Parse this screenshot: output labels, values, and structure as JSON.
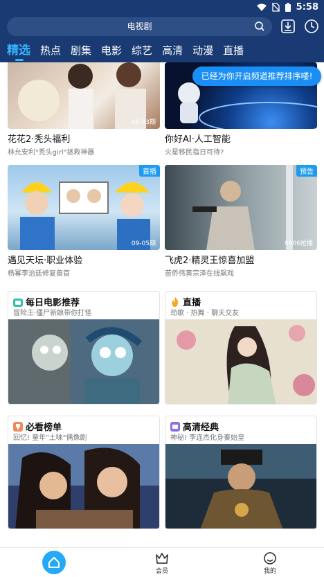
{
  "status_bar": {
    "time": "5:58"
  },
  "search": {
    "placeholder": "电视剧"
  },
  "tabs": [
    {
      "label": "精选",
      "active": true
    },
    {
      "label": "热点"
    },
    {
      "label": "剧集"
    },
    {
      "label": "电影"
    },
    {
      "label": "综艺"
    },
    {
      "label": "高清"
    },
    {
      "label": "动漫"
    },
    {
      "label": "直播"
    }
  ],
  "toast": "已经为你开启频道推荐排序喽!",
  "items": [
    {
      "title": "花花2·秃头福利",
      "subtitle": "林允安利\"秃头girl\"拯救神器",
      "date": "09-03期"
    },
    {
      "title": "你好AI·人工智能",
      "subtitle": "火星移民指日可待?"
    },
    {
      "title": "遇见天坛·职业体验",
      "subtitle": "杨幂李治廷修复兽首",
      "date": "09-05期",
      "badge": "首播"
    },
    {
      "title": "飞虎2·精灵王惊喜加盟",
      "subtitle": "苗侨伟黄宗泽在线飙戏",
      "date": "0906抢播",
      "badge": "预告"
    }
  ],
  "cards": [
    {
      "title": "每日电影推荐",
      "subtitle": "冒险王·僵尸新娘带你打怪",
      "icon": "tv-icon",
      "icon_color": "#2CC4A5"
    },
    {
      "title": "直播",
      "subtitle": "劲歌 · 热舞 · 聊天交友",
      "icon": "flame-icon",
      "icon_color": "#F5A623"
    },
    {
      "title": "必看榜单",
      "subtitle": "回忆! 童年\"土味\"偶像剧",
      "icon": "trophy-icon",
      "icon_color": "#F08A5D"
    },
    {
      "title": "高清经典",
      "subtitle": "神秘! 李连杰化身秦始皇",
      "icon": "hd-icon",
      "icon_color": "#8B6FE8"
    }
  ],
  "bottom_nav": [
    {
      "label": "",
      "icon": "home-icon",
      "active": true
    },
    {
      "label": "会员",
      "icon": "crown-icon"
    },
    {
      "label": "我的",
      "icon": "profile-icon"
    }
  ],
  "colors": {
    "header": "#193A73",
    "accent": "#34B3FF",
    "home_button": "#23A9F5"
  }
}
